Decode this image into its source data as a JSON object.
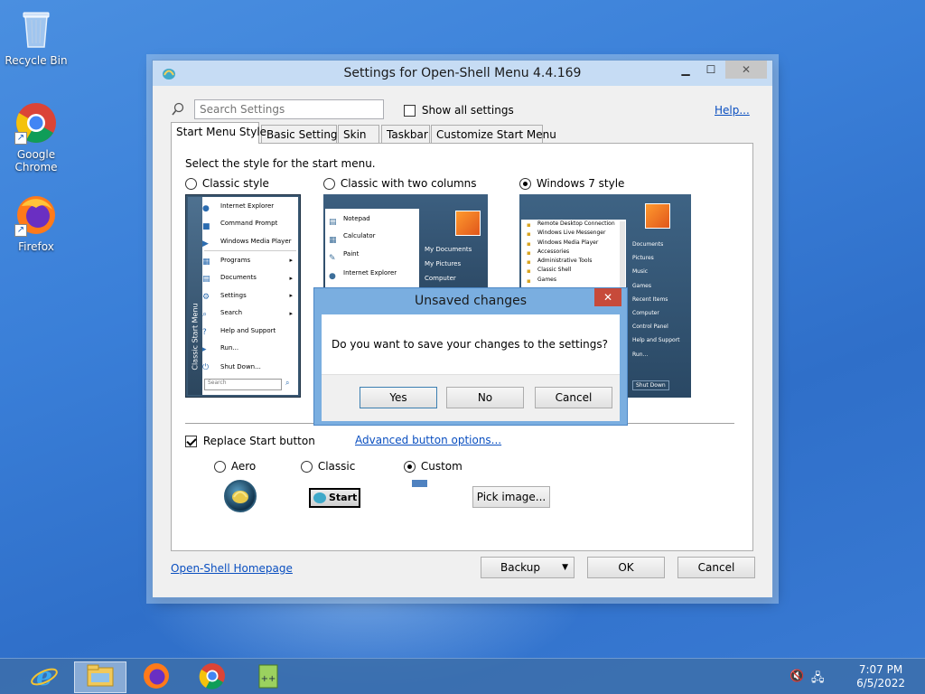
{
  "desktop": {
    "icons": [
      {
        "label": "Recycle Bin"
      },
      {
        "label": "Google Chrome"
      },
      {
        "label": "Firefox"
      }
    ]
  },
  "window": {
    "title": "Settings for Open-Shell Menu 4.4.169",
    "search_placeholder": "Search Settings",
    "show_all_label": "Show all settings",
    "help_link": "Help...",
    "tabs": [
      {
        "label": "Start Menu Style",
        "active": true
      },
      {
        "label": "Basic Settings"
      },
      {
        "label": "Skin"
      },
      {
        "label": "Taskbar"
      },
      {
        "label": "Customize Start Menu"
      }
    ],
    "panel": {
      "select_label": "Select the style for the start menu.",
      "styles": [
        {
          "label": "Classic style",
          "selected": false
        },
        {
          "label": "Classic with two columns",
          "selected": false
        },
        {
          "label": "Windows 7 style",
          "selected": true
        }
      ],
      "classic_preview": {
        "side_text": "Classic Start Menu",
        "items": [
          "Internet Explorer",
          "Command Prompt",
          "Windows Media Player",
          "Programs",
          "Documents",
          "Settings",
          "Search",
          "Help and Support",
          "Run...",
          "Shut Down..."
        ],
        "search": "Search"
      },
      "two_col_preview": {
        "left": [
          "Notepad",
          "Calculator",
          "Paint",
          "Internet Explorer"
        ],
        "right": [
          "My Documents",
          "My Pictures",
          "Computer"
        ]
      },
      "win7_preview": {
        "left": [
          "Remote Desktop Connection",
          "Windows Live Messenger",
          "Windows Media Player",
          "Accessories",
          "Administrative Tools",
          "Classic Shell",
          "Games"
        ],
        "right": [
          "Documents",
          "Pictures",
          "Music",
          "Games",
          "Recent Items",
          "Computer",
          "Control Panel",
          "Help and Support",
          "Run..."
        ],
        "shutdown": "Shut Down"
      },
      "replace_start_label": "Replace Start button",
      "replace_start_checked": true,
      "advanced_link": "Advanced button options...",
      "button_styles": [
        {
          "label": "Aero",
          "selected": false
        },
        {
          "label": "Classic",
          "selected": false
        },
        {
          "label": "Custom",
          "selected": true
        }
      ],
      "classic_button_text": "Start",
      "pick_image_label": "Pick image..."
    },
    "homepage_link": "Open-Shell Homepage",
    "backup_label": "Backup",
    "ok_label": "OK",
    "cancel_label": "Cancel"
  },
  "dialog": {
    "title": "Unsaved changes",
    "message": "Do you want to save your changes to the settings?",
    "yes_label": "Yes",
    "no_label": "No",
    "cancel_label": "Cancel",
    "close_glyph": "✕"
  },
  "taskbar": {
    "apps": [
      "Internet Explorer",
      "File Explorer",
      "Firefox",
      "Google Chrome",
      "Notepad++"
    ],
    "time": "7:07 PM",
    "date": "6/5/2022"
  },
  "colors": {
    "accent": "#0a4fc0",
    "title_bar": "#c6dcf4",
    "dialog_frame": "#7aaee0",
    "close_red": "#c74a3a"
  }
}
